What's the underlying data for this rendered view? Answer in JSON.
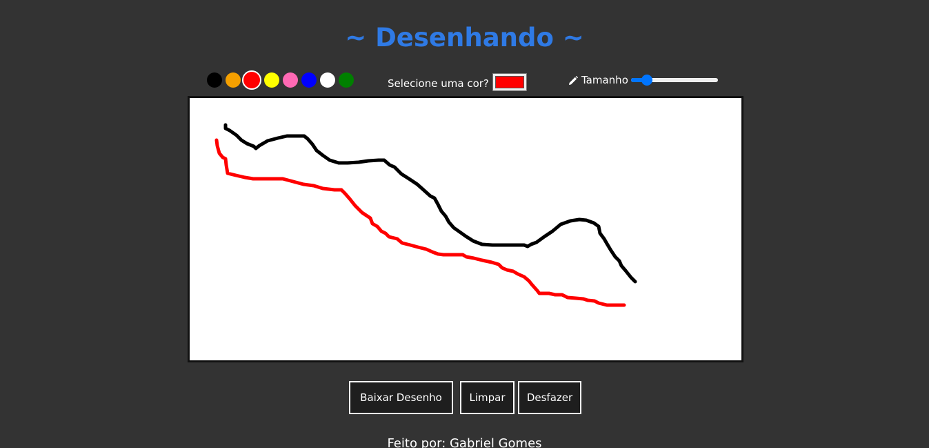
{
  "page": {
    "title": "~ Desenhando ~",
    "title_color": "#2f7ae5",
    "background": "#333333"
  },
  "palette": {
    "colors": [
      {
        "name": "black",
        "hex": "#000000",
        "selected": false
      },
      {
        "name": "orange",
        "hex": "#f5a000",
        "selected": false
      },
      {
        "name": "red",
        "hex": "#ff0000",
        "selected": true
      },
      {
        "name": "yellow",
        "hex": "#ffff00",
        "selected": false
      },
      {
        "name": "pink",
        "hex": "#ff69b4",
        "selected": false
      },
      {
        "name": "blue",
        "hex": "#0000ff",
        "selected": false
      },
      {
        "name": "white",
        "hex": "#ffffff",
        "selected": false
      },
      {
        "name": "green",
        "hex": "#008000",
        "selected": false
      }
    ]
  },
  "color_picker": {
    "label": "Selecione uma cor?",
    "value": "#ff0000"
  },
  "size_control": {
    "icon": "pencil-icon",
    "label": "Tamanho",
    "value_fraction": 0.18
  },
  "drawing": {
    "background": "#ffffff",
    "strokes": [
      {
        "color": "#000000",
        "description": "black freehand line"
      },
      {
        "color": "#ff0000",
        "description": "red freehand line"
      }
    ]
  },
  "buttons": {
    "download": "Baixar Desenho",
    "clear": "Limpar",
    "undo": "Desfazer"
  },
  "footer": {
    "text": "Feito por: Gabriel Gomes"
  }
}
